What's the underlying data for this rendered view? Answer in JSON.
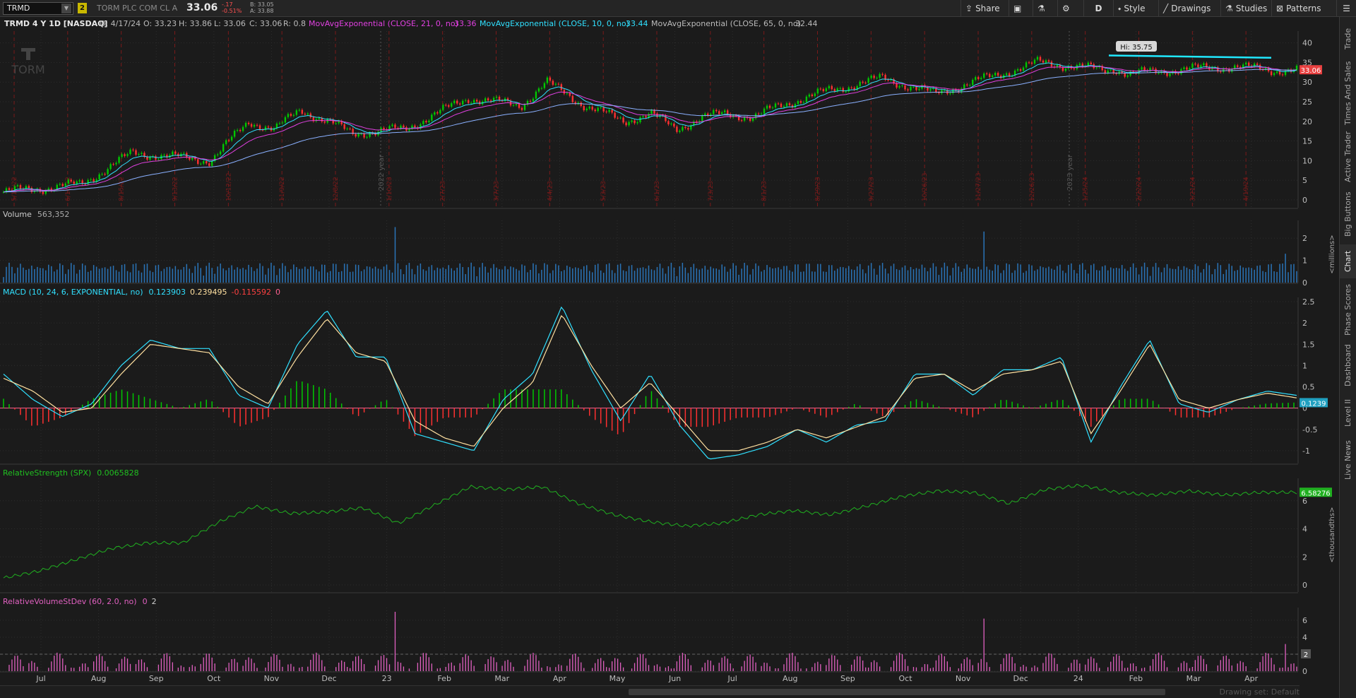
{
  "header": {
    "symbol": "TRMD",
    "link_number": "2",
    "description": "TORM PLC COM CL A",
    "last": "33.06",
    "change": "-.17",
    "change_pct": "-0.51%",
    "bid": "B: 33.05",
    "ask": "A: 33.88"
  },
  "toolbar": {
    "share": "Share",
    "timeframe": "D",
    "style": "Style",
    "drawings": "Drawings",
    "studies": "Studies",
    "patterns": "Patterns"
  },
  "infobar": {
    "title": "TRMD 4 Y 1D [NASDAQ]",
    "date": "D: 4/17/24",
    "open": "O: 33.23",
    "high": "H: 33.86",
    "low": "L: 33.06",
    "close": "C: 33.06",
    "range": "R: 0.8",
    "ema1_label": "MovAvgExponential (CLOSE, 21, 0, no)",
    "ema1_value": "33.36",
    "ema2_label": "MovAvgExponential (CLOSE, 10, 0, no)",
    "ema2_value": "33.44",
    "ema3_label": "MovAvgExponential (CLOSE, 65, 0, no)",
    "ema3_value": "32.44"
  },
  "side_tabs": [
    "Trade",
    "Times And Sales",
    "Active Trader",
    "Big Buttons",
    "Chart",
    "Phase Scores",
    "Dashboard",
    "Level II",
    "Live News"
  ],
  "colors": {
    "bg": "#1b1b1b",
    "up": "#00c800",
    "down": "#ff3030",
    "ema21": "#e040e0",
    "ema10": "#30e0ff",
    "ema65": "#8ab0ff",
    "volume": "#2a74b8",
    "macd_value": "#30e0ff",
    "macd_avg": "#ffe0a0",
    "rs": "#20b020",
    "rv": "#e060c0",
    "hi_line": "#20e8ff"
  },
  "chart_data": [
    {
      "type": "candlestick",
      "title": "TRMD 4 Y 1D [NASDAQ]",
      "company_label": "TORM",
      "x_months": [
        "Jul",
        "Aug",
        "Sep",
        "Oct",
        "Nov",
        "Dec",
        "23",
        "Feb",
        "Mar",
        "Apr",
        "May",
        "Jun",
        "Jul",
        "Aug",
        "Sep",
        "Oct",
        "Nov",
        "Dec",
        "24",
        "Feb",
        "Mar",
        "Apr"
      ],
      "y_ticks": [
        0,
        5,
        10,
        15,
        20,
        25,
        30,
        35,
        40
      ],
      "ylim": [
        -2,
        43
      ],
      "hi_label": "Hi: 35.75",
      "last_price_label": "33.06",
      "year_markers": [
        "2022 year",
        "2023 year"
      ],
      "event_dates": [
        "5/17/22",
        "6/16/22",
        "8/15/22",
        "9/13/22",
        "10/12/22",
        "11/9/22",
        "12/8/22",
        "1/10/23",
        "2/7/23",
        "3/7/23",
        "4/4/23",
        "5/3/23",
        "6/1/23",
        "7/3/23",
        "8/1/23",
        "8/29/23",
        "9/27/23",
        "10/26/23",
        "11/27/23",
        "12/26/23",
        "1/25/24",
        "2/22/24",
        "3/21/24",
        "4/19/24"
      ],
      "close_path_x": [
        0,
        0.06,
        0.1,
        0.16,
        0.19,
        0.21,
        0.23,
        0.27,
        0.31,
        0.36,
        0.4,
        0.42,
        0.45,
        0.48,
        0.5,
        0.52,
        0.54,
        0.56,
        0.58,
        0.6,
        0.64,
        0.68,
        0.72,
        0.76,
        0.8,
        0.83,
        0.85,
        0.86,
        0.87,
        0.9,
        0.95,
        0.98
      ],
      "close_path_y": [
        2,
        4,
        12,
        10,
        20,
        18,
        23,
        17,
        18,
        26,
        24,
        30,
        24,
        20,
        22,
        18,
        21,
        22,
        21,
        24,
        28,
        31,
        27,
        31,
        35,
        34,
        33,
        33.5,
        32,
        33,
        34,
        33.06
      ]
    },
    {
      "type": "bar",
      "title": "Volume",
      "value_label": "563,352",
      "unit_label": "<millions>",
      "y_ticks": [
        0,
        1,
        2
      ],
      "ylim": [
        0,
        2.8
      ]
    },
    {
      "type": "line",
      "title": "MACD (10, 24, 6, EXPONENTIAL, no)",
      "values": {
        "value": "0.123903",
        "avg": "0.239495",
        "diff": "-0.115592",
        "zero": "0"
      },
      "last_label": "0.1239",
      "y_ticks": [
        -1,
        -0.5,
        0,
        0.5,
        1,
        1.5,
        2,
        2.5
      ],
      "ylim": [
        -1.3,
        2.6
      ],
      "value_path_y": [
        0.8,
        0.2,
        -0.2,
        0.1,
        1,
        1.6,
        1.4,
        1.4,
        0.3,
        0,
        1.5,
        2.3,
        1.2,
        1.2,
        -0.6,
        -0.8,
        -1,
        0.2,
        0.8,
        2.4,
        0.9,
        -0.3,
        0.8,
        -0.4,
        -1.2,
        -1.1,
        -0.9,
        -0.5,
        -0.8,
        -0.4,
        -0.3,
        0.8,
        0.8,
        0.3,
        0.9,
        0.9,
        1.2,
        -0.8,
        0.5,
        1.6,
        0.1,
        -0.1,
        0.2,
        0.4,
        0.3
      ],
      "avg_path_y": [
        0.7,
        0.4,
        -0.1,
        0,
        0.8,
        1.5,
        1.4,
        1.3,
        0.5,
        0.1,
        1.2,
        2.1,
        1.3,
        1.1,
        -0.3,
        -0.7,
        -0.9,
        0,
        0.6,
        2.2,
        1,
        0,
        0.6,
        -0.2,
        -1.0,
        -1.0,
        -0.8,
        -0.5,
        -0.7,
        -0.45,
        -0.2,
        0.7,
        0.8,
        0.4,
        0.8,
        0.9,
        1.1,
        -0.6,
        0.4,
        1.5,
        0.2,
        0,
        0.2,
        0.35,
        0.24
      ]
    },
    {
      "type": "line",
      "title": "RelativeStrength (SPX)",
      "value_label": "0.0065828",
      "last_label": "6.58276",
      "unit_label": "<thousandths>",
      "y_ticks": [
        0,
        2,
        4,
        6
      ],
      "ylim": [
        -0.5,
        7.6
      ],
      "path_y": [
        0.5,
        1,
        1.8,
        2.6,
        3,
        3,
        4.5,
        5.6,
        5.1,
        5.2,
        5.5,
        4.4,
        5.7,
        7,
        6.8,
        7,
        5.8,
        5,
        4.5,
        4.2,
        4.4,
        5,
        5.3,
        5,
        5.6,
        6.3,
        6.7,
        6.6,
        5.8,
        6.8,
        7.1,
        6.6,
        6.4,
        6.7,
        6.4,
        6.6,
        6.6
      ]
    },
    {
      "type": "bar",
      "title": "RelativeVolumeStDev (60, 2.0, no)",
      "values": {
        "a": "0",
        "b": "2"
      },
      "threshold_label": "2",
      "y_ticks": [
        0,
        2,
        4,
        6
      ],
      "ylim": [
        0,
        7.5
      ]
    }
  ],
  "footer": {
    "drawing_set": "Drawing set: Default"
  }
}
